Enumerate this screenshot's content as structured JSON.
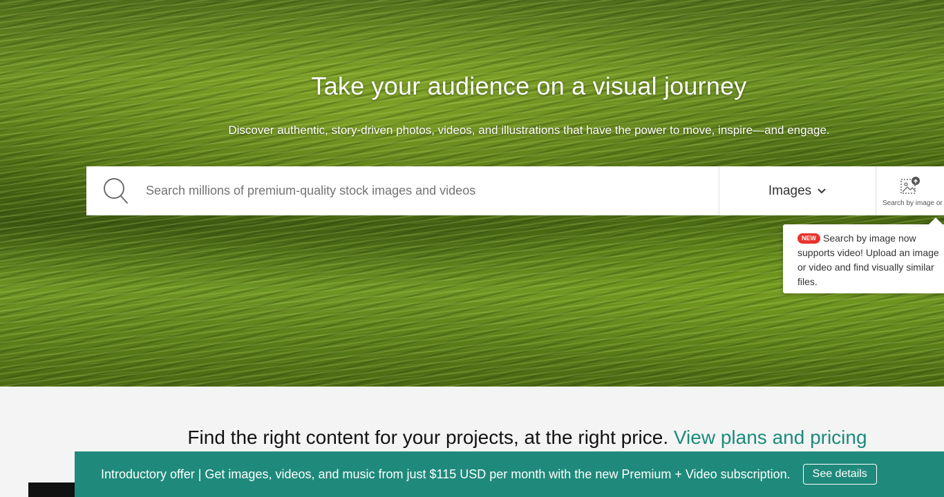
{
  "hero": {
    "title": "Take your audience on a visual journey",
    "subtitle": "Discover authentic, story-driven photos, videos, and illustrations that have the power to move, inspire—and engage."
  },
  "search": {
    "placeholder": "Search millions of premium-quality stock images and videos",
    "value": "",
    "type_label": "Images",
    "image_search_label": "Search by image or video"
  },
  "tooltip": {
    "badge": "NEW",
    "text": "Search by image now supports video! Upload an image or video and find visually similar files."
  },
  "pricing": {
    "text": "Find the right content for your projects, at the right price.",
    "link": "View plans and pricing"
  },
  "promo": {
    "text": "Introductory offer | Get images, videos, and music from just $115 USD per month with the new Premium + Video subscription.",
    "button": "See details"
  },
  "colors": {
    "accent": "#1f8a7b",
    "badge": "#e8332c"
  },
  "icons": {
    "search": "search-icon",
    "dropdown": "chevron-down-icon",
    "image_search": "image-upload-icon"
  }
}
